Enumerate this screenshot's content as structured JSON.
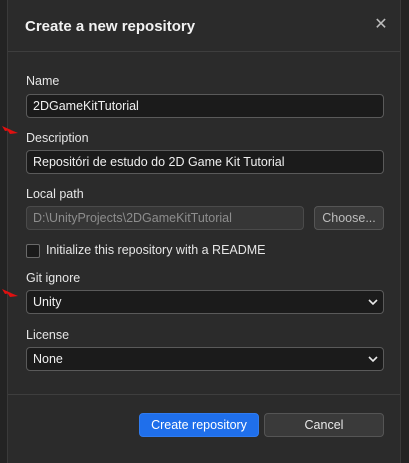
{
  "dialog": {
    "title": "Create a new repository",
    "close_glyph": "✕"
  },
  "fields": {
    "name": {
      "label": "Name",
      "value": "2DGameKitTutorial"
    },
    "description": {
      "label": "Description",
      "value": "Repositóri de estudo do 2D Game Kit Tutorial"
    },
    "local_path": {
      "label": "Local path",
      "value": "D:\\UnityProjects\\2DGameKitTutorial",
      "choose_label": "Choose..."
    },
    "readme": {
      "label": "Initialize this repository with a README",
      "checked": false
    },
    "git_ignore": {
      "label": "Git ignore",
      "selected": "Unity"
    },
    "license": {
      "label": "License",
      "selected": "None"
    }
  },
  "footer": {
    "create_label": "Create repository",
    "cancel_label": "Cancel"
  },
  "colors": {
    "primary": "#1f6feb",
    "annotation_arrow": "#e01010"
  },
  "icons": {
    "close": "close-icon",
    "dropdown": "chevron-down-icon",
    "annotation": "red-arrow-icon"
  }
}
